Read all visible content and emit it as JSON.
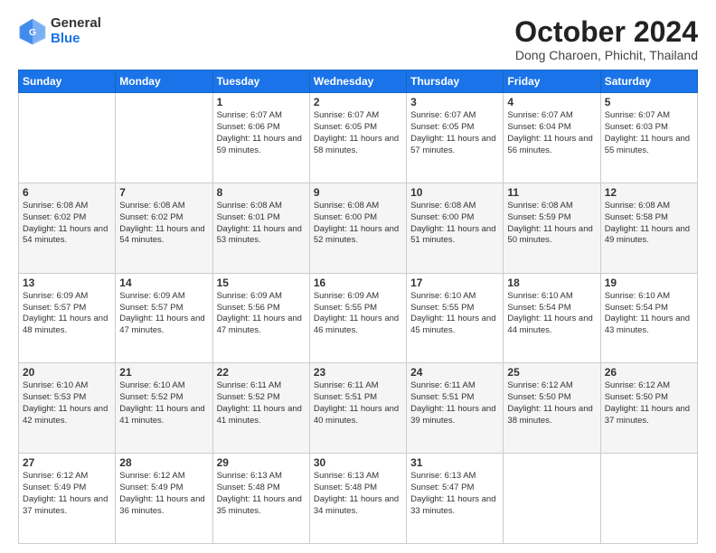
{
  "logo": {
    "general": "General",
    "blue": "Blue"
  },
  "title": "October 2024",
  "location": "Dong Charoen, Phichit, Thailand",
  "days": [
    "Sunday",
    "Monday",
    "Tuesday",
    "Wednesday",
    "Thursday",
    "Friday",
    "Saturday"
  ],
  "weeks": [
    [
      {
        "day": "",
        "info": ""
      },
      {
        "day": "",
        "info": ""
      },
      {
        "day": "1",
        "info": "Sunrise: 6:07 AM\nSunset: 6:06 PM\nDaylight: 11 hours and 59 minutes."
      },
      {
        "day": "2",
        "info": "Sunrise: 6:07 AM\nSunset: 6:05 PM\nDaylight: 11 hours and 58 minutes."
      },
      {
        "day": "3",
        "info": "Sunrise: 6:07 AM\nSunset: 6:05 PM\nDaylight: 11 hours and 57 minutes."
      },
      {
        "day": "4",
        "info": "Sunrise: 6:07 AM\nSunset: 6:04 PM\nDaylight: 11 hours and 56 minutes."
      },
      {
        "day": "5",
        "info": "Sunrise: 6:07 AM\nSunset: 6:03 PM\nDaylight: 11 hours and 55 minutes."
      }
    ],
    [
      {
        "day": "6",
        "info": "Sunrise: 6:08 AM\nSunset: 6:02 PM\nDaylight: 11 hours and 54 minutes."
      },
      {
        "day": "7",
        "info": "Sunrise: 6:08 AM\nSunset: 6:02 PM\nDaylight: 11 hours and 54 minutes."
      },
      {
        "day": "8",
        "info": "Sunrise: 6:08 AM\nSunset: 6:01 PM\nDaylight: 11 hours and 53 minutes."
      },
      {
        "day": "9",
        "info": "Sunrise: 6:08 AM\nSunset: 6:00 PM\nDaylight: 11 hours and 52 minutes."
      },
      {
        "day": "10",
        "info": "Sunrise: 6:08 AM\nSunset: 6:00 PM\nDaylight: 11 hours and 51 minutes."
      },
      {
        "day": "11",
        "info": "Sunrise: 6:08 AM\nSunset: 5:59 PM\nDaylight: 11 hours and 50 minutes."
      },
      {
        "day": "12",
        "info": "Sunrise: 6:08 AM\nSunset: 5:58 PM\nDaylight: 11 hours and 49 minutes."
      }
    ],
    [
      {
        "day": "13",
        "info": "Sunrise: 6:09 AM\nSunset: 5:57 PM\nDaylight: 11 hours and 48 minutes."
      },
      {
        "day": "14",
        "info": "Sunrise: 6:09 AM\nSunset: 5:57 PM\nDaylight: 11 hours and 47 minutes."
      },
      {
        "day": "15",
        "info": "Sunrise: 6:09 AM\nSunset: 5:56 PM\nDaylight: 11 hours and 47 minutes."
      },
      {
        "day": "16",
        "info": "Sunrise: 6:09 AM\nSunset: 5:55 PM\nDaylight: 11 hours and 46 minutes."
      },
      {
        "day": "17",
        "info": "Sunrise: 6:10 AM\nSunset: 5:55 PM\nDaylight: 11 hours and 45 minutes."
      },
      {
        "day": "18",
        "info": "Sunrise: 6:10 AM\nSunset: 5:54 PM\nDaylight: 11 hours and 44 minutes."
      },
      {
        "day": "19",
        "info": "Sunrise: 6:10 AM\nSunset: 5:54 PM\nDaylight: 11 hours and 43 minutes."
      }
    ],
    [
      {
        "day": "20",
        "info": "Sunrise: 6:10 AM\nSunset: 5:53 PM\nDaylight: 11 hours and 42 minutes."
      },
      {
        "day": "21",
        "info": "Sunrise: 6:10 AM\nSunset: 5:52 PM\nDaylight: 11 hours and 41 minutes."
      },
      {
        "day": "22",
        "info": "Sunrise: 6:11 AM\nSunset: 5:52 PM\nDaylight: 11 hours and 41 minutes."
      },
      {
        "day": "23",
        "info": "Sunrise: 6:11 AM\nSunset: 5:51 PM\nDaylight: 11 hours and 40 minutes."
      },
      {
        "day": "24",
        "info": "Sunrise: 6:11 AM\nSunset: 5:51 PM\nDaylight: 11 hours and 39 minutes."
      },
      {
        "day": "25",
        "info": "Sunrise: 6:12 AM\nSunset: 5:50 PM\nDaylight: 11 hours and 38 minutes."
      },
      {
        "day": "26",
        "info": "Sunrise: 6:12 AM\nSunset: 5:50 PM\nDaylight: 11 hours and 37 minutes."
      }
    ],
    [
      {
        "day": "27",
        "info": "Sunrise: 6:12 AM\nSunset: 5:49 PM\nDaylight: 11 hours and 37 minutes."
      },
      {
        "day": "28",
        "info": "Sunrise: 6:12 AM\nSunset: 5:49 PM\nDaylight: 11 hours and 36 minutes."
      },
      {
        "day": "29",
        "info": "Sunrise: 6:13 AM\nSunset: 5:48 PM\nDaylight: 11 hours and 35 minutes."
      },
      {
        "day": "30",
        "info": "Sunrise: 6:13 AM\nSunset: 5:48 PM\nDaylight: 11 hours and 34 minutes."
      },
      {
        "day": "31",
        "info": "Sunrise: 6:13 AM\nSunset: 5:47 PM\nDaylight: 11 hours and 33 minutes."
      },
      {
        "day": "",
        "info": ""
      },
      {
        "day": "",
        "info": ""
      }
    ]
  ]
}
